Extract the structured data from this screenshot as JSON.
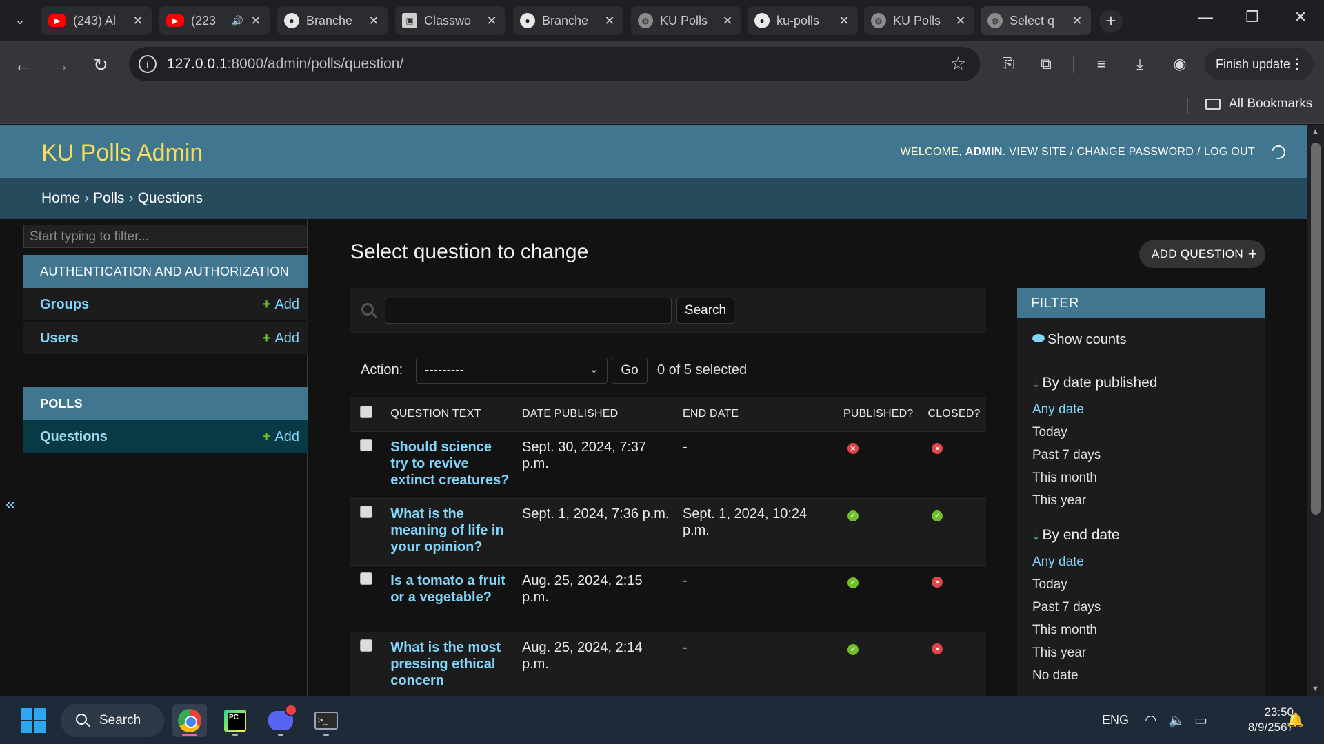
{
  "browser": {
    "tabs": [
      {
        "label": "(243) Al",
        "icon": "youtube-icon",
        "sound": false
      },
      {
        "label": "(223",
        "icon": "youtube-icon",
        "sound": true
      },
      {
        "label": "Branche",
        "icon": "github-icon",
        "sound": false
      },
      {
        "label": "Classwo",
        "icon": "classroom-icon",
        "sound": false
      },
      {
        "label": "Branche",
        "icon": "github-icon",
        "sound": false
      },
      {
        "label": "KU Polls",
        "icon": "globe-icon",
        "sound": false
      },
      {
        "label": "ku-polls",
        "icon": "github-icon",
        "sound": false
      },
      {
        "label": "KU Polls",
        "icon": "globe-icon",
        "sound": false
      },
      {
        "label": "Select q",
        "icon": "globe-icon",
        "sound": false,
        "active": true
      }
    ],
    "url_host": "127.0.0.1",
    "url_rest": ":8000/admin/polls/question/",
    "finish_update": "Finish update",
    "all_bookmarks": "All Bookmarks"
  },
  "admin": {
    "branding": "KU Polls Admin",
    "welcome": "WELCOME,",
    "user": "ADMIN",
    "view_site": "VIEW SITE",
    "change_password": "CHANGE PASSWORD",
    "log_out": "LOG OUT",
    "breadcrumbs": [
      "Home",
      "Polls",
      "Questions"
    ],
    "sidebar": {
      "filter_placeholder": "Start typing to filter...",
      "auth_caption": "AUTHENTICATION AND AUTHORIZATION",
      "auth_items": [
        "Groups",
        "Users"
      ],
      "polls_caption": "POLLS",
      "polls_items": [
        "Questions"
      ],
      "add_label": "Add",
      "collapse": "«"
    },
    "title": "Select question to change",
    "add_button": "ADD QUESTION",
    "search_button": "Search",
    "action_label": "Action:",
    "action_value": "---------",
    "go_button": "Go",
    "counter": "0 of 5 selected",
    "columns": [
      "QUESTION TEXT",
      "DATE PUBLISHED",
      "END DATE",
      "PUBLISHED?",
      "CLOSED?"
    ],
    "rows": [
      {
        "q": "Should science try to revive extinct creatures?",
        "date": "Sept. 30, 2024, 7:37 p.m.",
        "end": "-",
        "published": false,
        "closed": false
      },
      {
        "q": "What is the meaning of life in your opinion?",
        "date": "Sept. 1, 2024, 7:36 p.m.",
        "end": "Sept. 1, 2024, 10:24 p.m.",
        "published": true,
        "closed": true
      },
      {
        "q": "Is a tomato a fruit or a vegetable?",
        "date": "Aug. 25, 2024, 2:15 p.m.",
        "end": "-",
        "published": true,
        "closed": false
      },
      {
        "q": "What is the most pressing ethical concern",
        "date": "Aug. 25, 2024, 2:14 p.m.",
        "end": "-",
        "published": true,
        "closed": false
      }
    ],
    "filter": {
      "heading": "FILTER",
      "show_counts": "Show counts",
      "groups": [
        {
          "title": "By date published",
          "options": [
            "Any date",
            "Today",
            "Past 7 days",
            "This month",
            "This year"
          ]
        },
        {
          "title": "By end date",
          "options": [
            "Any date",
            "Today",
            "Past 7 days",
            "This month",
            "This year",
            "No date"
          ]
        }
      ]
    }
  },
  "taskbar": {
    "search": "Search",
    "lang": "ENG",
    "time": "23:50",
    "date": "8/9/2567"
  },
  "colors": {
    "header": "#417690",
    "breadcrumbs": "#264b5d",
    "branding": "#f5dd5d",
    "link": "#81d4fa",
    "yes": "#70bf2b",
    "no": "#dd4646"
  }
}
